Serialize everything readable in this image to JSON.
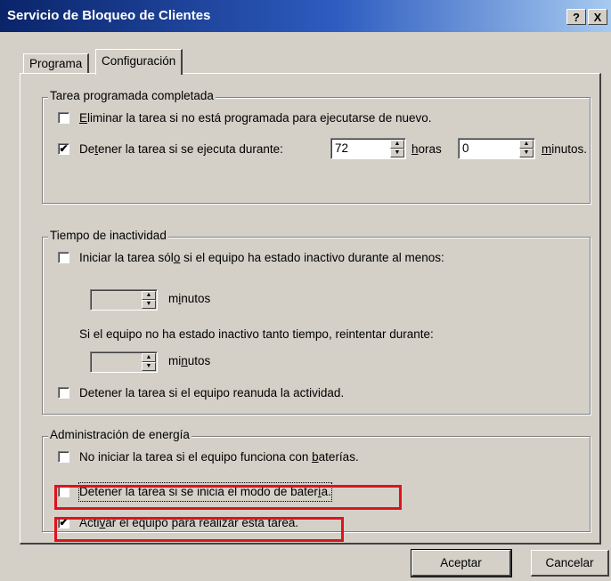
{
  "window": {
    "title": "Servicio de Bloqueo de Clientes",
    "help_label": "?",
    "close_label": "X"
  },
  "tabs": [
    {
      "label": "Programa",
      "active": false
    },
    {
      "label": "Configuración",
      "active": true
    }
  ],
  "scheduled_group": {
    "legend": "Tarea programada completada",
    "delete_task": {
      "checked": false,
      "mnemonic": "E",
      "rest": "liminar la tarea si no está programada para ejecutarse de nuevo."
    },
    "stop_task": {
      "checked": true,
      "pre": "De",
      "mnemonic": "t",
      "rest": "ener la tarea si se ejecuta durante:"
    },
    "hours_value": "72",
    "hours_label_mnemonic": "h",
    "hours_label_rest": "oras",
    "minutes_value": "0",
    "minutes_label_mnemonic": "m",
    "minutes_label_rest": "inutos."
  },
  "idle_group": {
    "legend": "Tiempo de inactividad",
    "start_idle": {
      "checked": false,
      "pre": "Iniciar la tarea sól",
      "mnemonic": "o",
      "rest": " si el equipo ha estado inactivo durante al menos:"
    },
    "idle_minutes_value": "",
    "idle_minutes_pre": "m",
    "idle_minutes_mnemonic": "i",
    "idle_minutes_rest": "nutos",
    "retry_text": "Si el equipo no ha estado inactivo tanto tiempo, reintentar durante:",
    "retry_minutes_value": "",
    "retry_minutes_pre": "mi",
    "retry_minutes_mnemonic": "n",
    "retry_minutes_rest": "utos",
    "stop_resume": {
      "checked": false,
      "pre": "Detener la tarea si el equipo reanuda la actividad.",
      "mnemonic": "",
      "rest": ""
    }
  },
  "power_group": {
    "legend": "Administración de energía",
    "no_start_battery": {
      "checked": false,
      "pre": "No iniciar la tarea si el equipo funciona con ",
      "mnemonic": "b",
      "rest": "aterías."
    },
    "stop_battery": {
      "checked": false,
      "pre": "Detener la tarea si se inicia el modo de bater",
      "mnemonic": "í",
      "rest": "a."
    },
    "wake_computer": {
      "checked": true,
      "pre": "Acti",
      "mnemonic": "v",
      "rest": "ar el equipo para realizar esta tarea."
    }
  },
  "buttons": {
    "accept": "Aceptar",
    "cancel": "Cancelar"
  },
  "colors": {
    "highlight": "#e0121c",
    "titlebar": "#0a246a",
    "face": "#d4d0c8"
  }
}
